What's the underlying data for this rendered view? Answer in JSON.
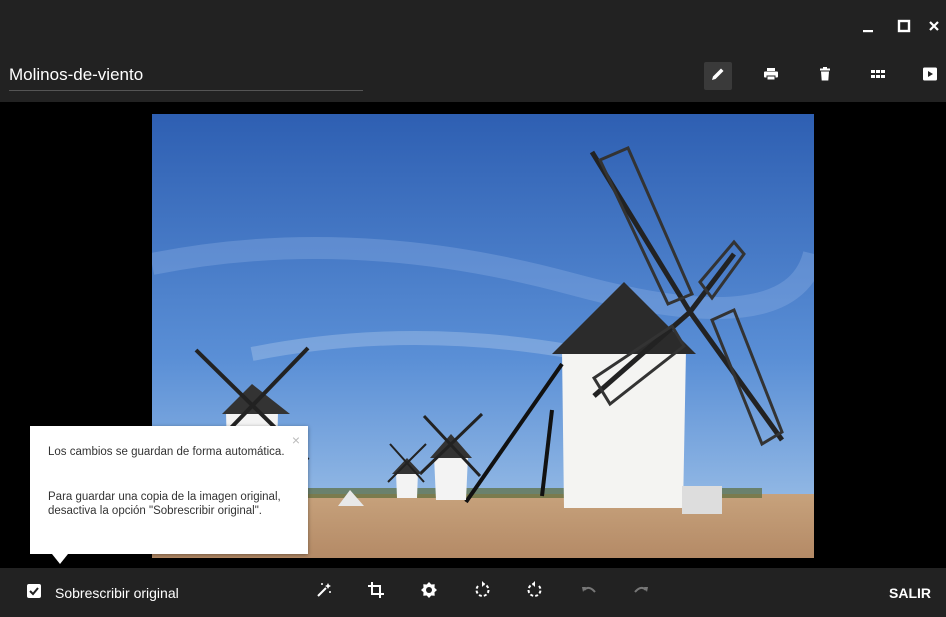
{
  "window": {
    "minimize_icon": "minimize-icon",
    "maximize_icon": "maximize-icon",
    "close_icon": "close-icon"
  },
  "toolbar": {
    "filename": "Molinos-de-viento",
    "tools": [
      "edit-icon",
      "print-icon",
      "delete-icon",
      "grid-icon",
      "slideshow-icon"
    ]
  },
  "tooltip": {
    "line1": "Los cambios se guardan de forma automática.",
    "line2": "Para guardar una copia de la imagen original, desactiva la opción \"Sobrescribir original\".",
    "close_glyph": "×"
  },
  "bottombar": {
    "overwrite_label": "Sobrescribir original",
    "overwrite_checked": true,
    "tools": [
      "auto-fix-icon",
      "crop-icon",
      "brightness-icon",
      "rotate-left-icon",
      "rotate-right-icon",
      "undo-icon",
      "redo-icon"
    ],
    "exit_label": "SALIR"
  },
  "colors": {
    "bar": "#222222",
    "background": "#000000",
    "text": "#ffffff",
    "disabled": "#777777"
  }
}
